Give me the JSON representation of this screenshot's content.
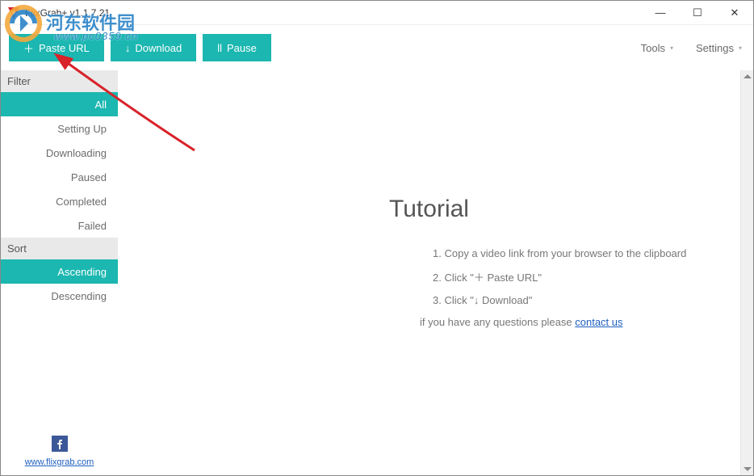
{
  "window": {
    "title": "FlixGrab+ v1.1.7.21"
  },
  "toolbar": {
    "paste_label": "Paste URL",
    "download_label": "Download",
    "pause_label": "Pause",
    "tools_label": "Tools",
    "settings_label": "Settings"
  },
  "sidebar": {
    "filter_header": "Filter",
    "sort_header": "Sort",
    "filters": {
      "all": "All",
      "setting_up": "Setting Up",
      "downloading": "Downloading",
      "paused": "Paused",
      "completed": "Completed",
      "failed": "Failed"
    },
    "sorts": {
      "ascending": "Ascending",
      "descending": "Descending"
    },
    "website": "www.flixgrab.com"
  },
  "tutorial": {
    "heading": "Tutorial",
    "step1": "Copy a video link from your browser to the clipboard",
    "step2": "Click \"＋ Paste URL\"",
    "step3": "Click \"↓ Download\"",
    "note_prefix": "if you have any questions please ",
    "contact": "contact us"
  },
  "watermark": {
    "text": "河东软件园",
    "sub": "www.pc0359.cn"
  }
}
